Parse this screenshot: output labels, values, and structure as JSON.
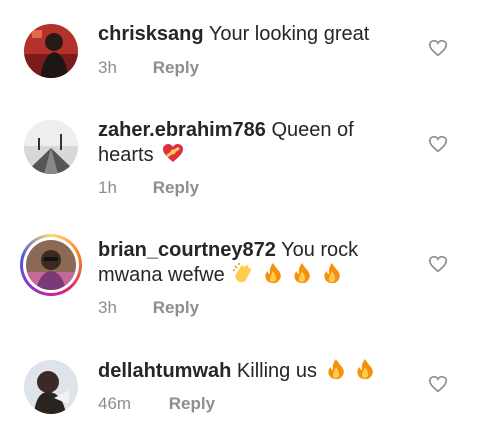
{
  "comments": [
    {
      "username": "chrisksang",
      "text": "Your looking great",
      "time": "3h",
      "reply": "Reply",
      "emojis": []
    },
    {
      "username": "zaher.ebrahim786",
      "text": "Queen of hearts",
      "time": "1h",
      "reply": "Reply",
      "emojis": [
        "heart-with-ribbon"
      ]
    },
    {
      "username": "brian_courtney872",
      "text": "You rock mwana wefwe",
      "time": "3h",
      "reply": "Reply",
      "emojis": [
        "clapping-hands",
        "fire",
        "fire",
        "fire"
      ]
    },
    {
      "username": "dellahtumwah",
      "text": "Killing us",
      "time": "46m",
      "reply": "Reply",
      "emojis": [
        "fire",
        "fire"
      ]
    }
  ],
  "colors": {
    "text": "#262626",
    "meta": "#8e8e8e",
    "fire": "#f4900c",
    "heart_icon": "#8e8e8e"
  }
}
